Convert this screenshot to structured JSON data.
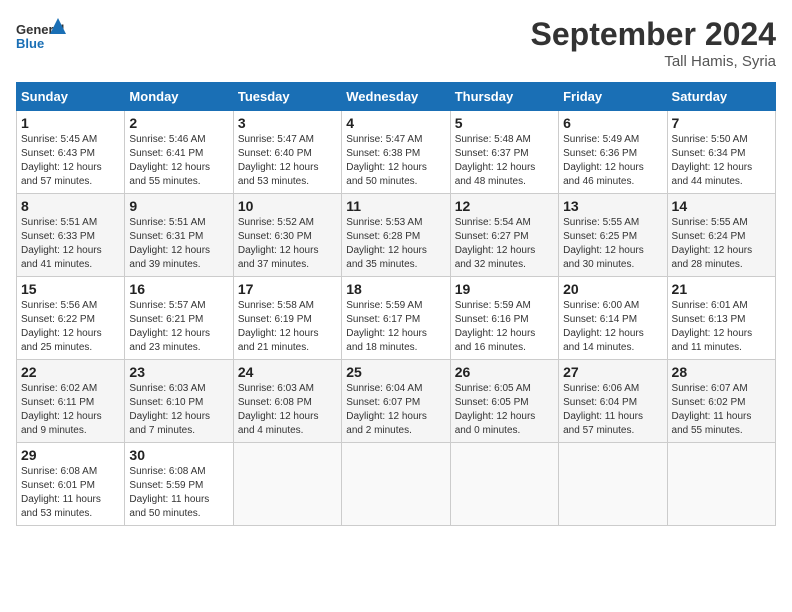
{
  "header": {
    "logo_line1": "General",
    "logo_line2": "Blue",
    "month": "September 2024",
    "location": "Tall Hamis, Syria"
  },
  "days_of_week": [
    "Sunday",
    "Monday",
    "Tuesday",
    "Wednesday",
    "Thursday",
    "Friday",
    "Saturday"
  ],
  "weeks": [
    [
      {
        "day": "1",
        "info": "Sunrise: 5:45 AM\nSunset: 6:43 PM\nDaylight: 12 hours\nand 57 minutes."
      },
      {
        "day": "2",
        "info": "Sunrise: 5:46 AM\nSunset: 6:41 PM\nDaylight: 12 hours\nand 55 minutes."
      },
      {
        "day": "3",
        "info": "Sunrise: 5:47 AM\nSunset: 6:40 PM\nDaylight: 12 hours\nand 53 minutes."
      },
      {
        "day": "4",
        "info": "Sunrise: 5:47 AM\nSunset: 6:38 PM\nDaylight: 12 hours\nand 50 minutes."
      },
      {
        "day": "5",
        "info": "Sunrise: 5:48 AM\nSunset: 6:37 PM\nDaylight: 12 hours\nand 48 minutes."
      },
      {
        "day": "6",
        "info": "Sunrise: 5:49 AM\nSunset: 6:36 PM\nDaylight: 12 hours\nand 46 minutes."
      },
      {
        "day": "7",
        "info": "Sunrise: 5:50 AM\nSunset: 6:34 PM\nDaylight: 12 hours\nand 44 minutes."
      }
    ],
    [
      {
        "day": "8",
        "info": "Sunrise: 5:51 AM\nSunset: 6:33 PM\nDaylight: 12 hours\nand 41 minutes."
      },
      {
        "day": "9",
        "info": "Sunrise: 5:51 AM\nSunset: 6:31 PM\nDaylight: 12 hours\nand 39 minutes."
      },
      {
        "day": "10",
        "info": "Sunrise: 5:52 AM\nSunset: 6:30 PM\nDaylight: 12 hours\nand 37 minutes."
      },
      {
        "day": "11",
        "info": "Sunrise: 5:53 AM\nSunset: 6:28 PM\nDaylight: 12 hours\nand 35 minutes."
      },
      {
        "day": "12",
        "info": "Sunrise: 5:54 AM\nSunset: 6:27 PM\nDaylight: 12 hours\nand 32 minutes."
      },
      {
        "day": "13",
        "info": "Sunrise: 5:55 AM\nSunset: 6:25 PM\nDaylight: 12 hours\nand 30 minutes."
      },
      {
        "day": "14",
        "info": "Sunrise: 5:55 AM\nSunset: 6:24 PM\nDaylight: 12 hours\nand 28 minutes."
      }
    ],
    [
      {
        "day": "15",
        "info": "Sunrise: 5:56 AM\nSunset: 6:22 PM\nDaylight: 12 hours\nand 25 minutes."
      },
      {
        "day": "16",
        "info": "Sunrise: 5:57 AM\nSunset: 6:21 PM\nDaylight: 12 hours\nand 23 minutes."
      },
      {
        "day": "17",
        "info": "Sunrise: 5:58 AM\nSunset: 6:19 PM\nDaylight: 12 hours\nand 21 minutes."
      },
      {
        "day": "18",
        "info": "Sunrise: 5:59 AM\nSunset: 6:17 PM\nDaylight: 12 hours\nand 18 minutes."
      },
      {
        "day": "19",
        "info": "Sunrise: 5:59 AM\nSunset: 6:16 PM\nDaylight: 12 hours\nand 16 minutes."
      },
      {
        "day": "20",
        "info": "Sunrise: 6:00 AM\nSunset: 6:14 PM\nDaylight: 12 hours\nand 14 minutes."
      },
      {
        "day": "21",
        "info": "Sunrise: 6:01 AM\nSunset: 6:13 PM\nDaylight: 12 hours\nand 11 minutes."
      }
    ],
    [
      {
        "day": "22",
        "info": "Sunrise: 6:02 AM\nSunset: 6:11 PM\nDaylight: 12 hours\nand 9 minutes."
      },
      {
        "day": "23",
        "info": "Sunrise: 6:03 AM\nSunset: 6:10 PM\nDaylight: 12 hours\nand 7 minutes."
      },
      {
        "day": "24",
        "info": "Sunrise: 6:03 AM\nSunset: 6:08 PM\nDaylight: 12 hours\nand 4 minutes."
      },
      {
        "day": "25",
        "info": "Sunrise: 6:04 AM\nSunset: 6:07 PM\nDaylight: 12 hours\nand 2 minutes."
      },
      {
        "day": "26",
        "info": "Sunrise: 6:05 AM\nSunset: 6:05 PM\nDaylight: 12 hours\nand 0 minutes."
      },
      {
        "day": "27",
        "info": "Sunrise: 6:06 AM\nSunset: 6:04 PM\nDaylight: 11 hours\nand 57 minutes."
      },
      {
        "day": "28",
        "info": "Sunrise: 6:07 AM\nSunset: 6:02 PM\nDaylight: 11 hours\nand 55 minutes."
      }
    ],
    [
      {
        "day": "29",
        "info": "Sunrise: 6:08 AM\nSunset: 6:01 PM\nDaylight: 11 hours\nand 53 minutes."
      },
      {
        "day": "30",
        "info": "Sunrise: 6:08 AM\nSunset: 5:59 PM\nDaylight: 11 hours\nand 50 minutes."
      },
      {
        "day": "",
        "info": ""
      },
      {
        "day": "",
        "info": ""
      },
      {
        "day": "",
        "info": ""
      },
      {
        "day": "",
        "info": ""
      },
      {
        "day": "",
        "info": ""
      }
    ]
  ]
}
